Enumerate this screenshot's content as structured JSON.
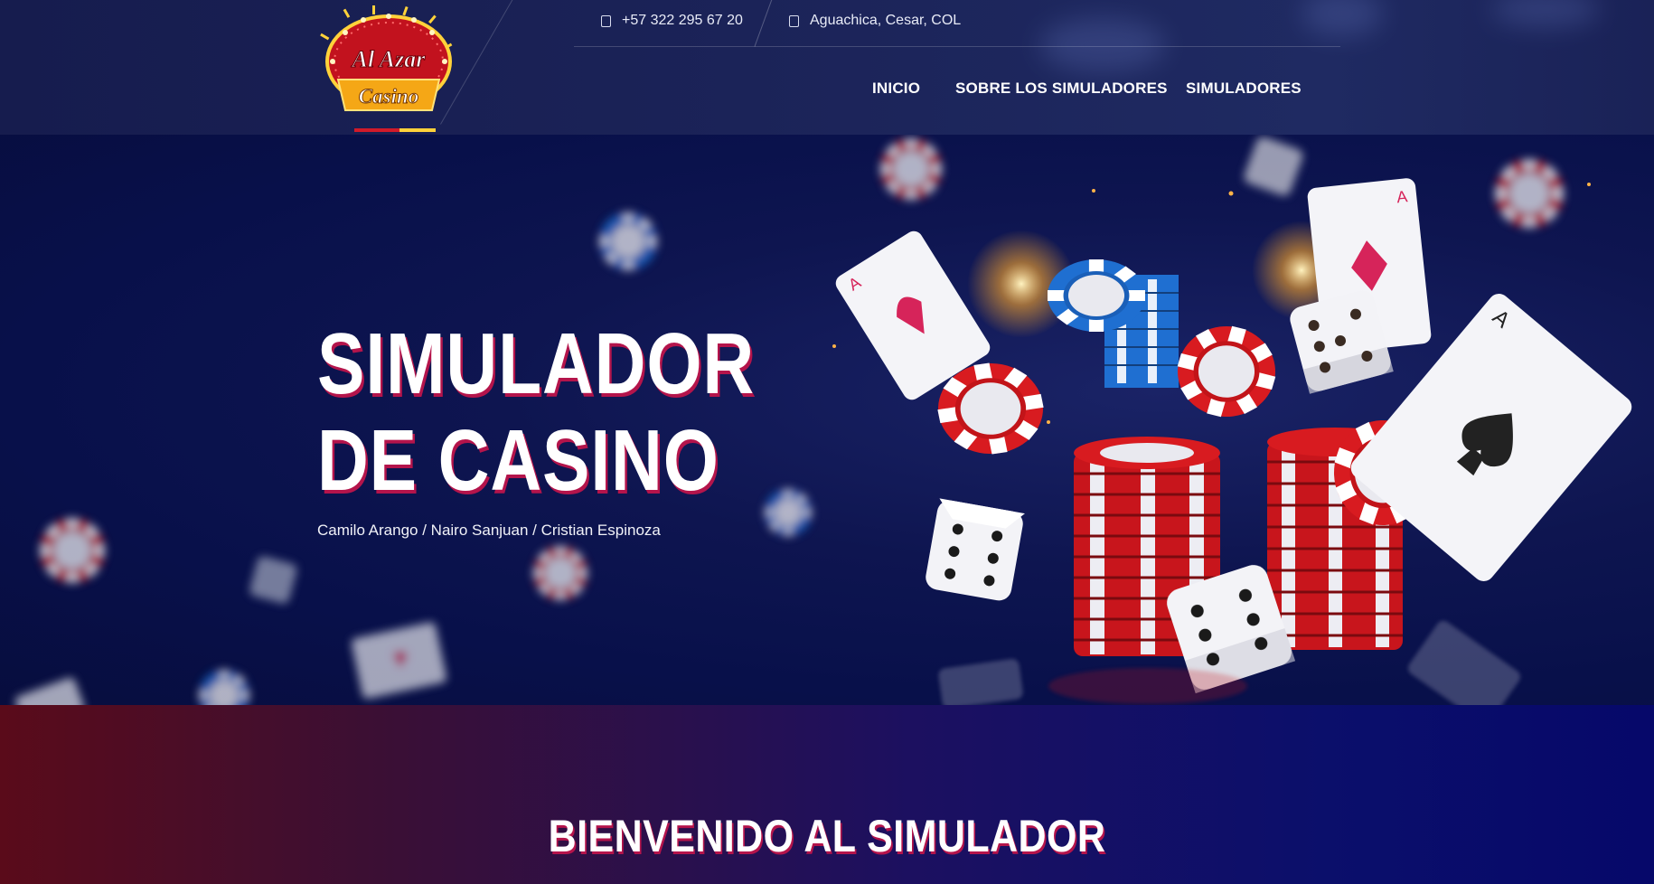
{
  "brand": {
    "line1": "Al Azar",
    "line2": "Casino"
  },
  "contact": {
    "phone": "+57 322 295 67 20",
    "address": "Aguachica, Cesar, COL"
  },
  "nav": {
    "items": [
      "INICIO",
      "SOBRE LOS SIMULADORES",
      "SIMULADORES"
    ]
  },
  "hero": {
    "title": "SIMULADOR DE CASINO",
    "authors": "Camilo Arango / Nairo Sanjuan / Cristian Espinoza"
  },
  "welcome": {
    "heading": "BIENVENIDO AL SIMULADOR"
  },
  "icons": {
    "phone": "phone-icon",
    "location": "location-icon"
  },
  "colors": {
    "accent_shadow": "#b4144b",
    "header_bg": "#1b2358",
    "hero_bg": "#0e1550"
  }
}
